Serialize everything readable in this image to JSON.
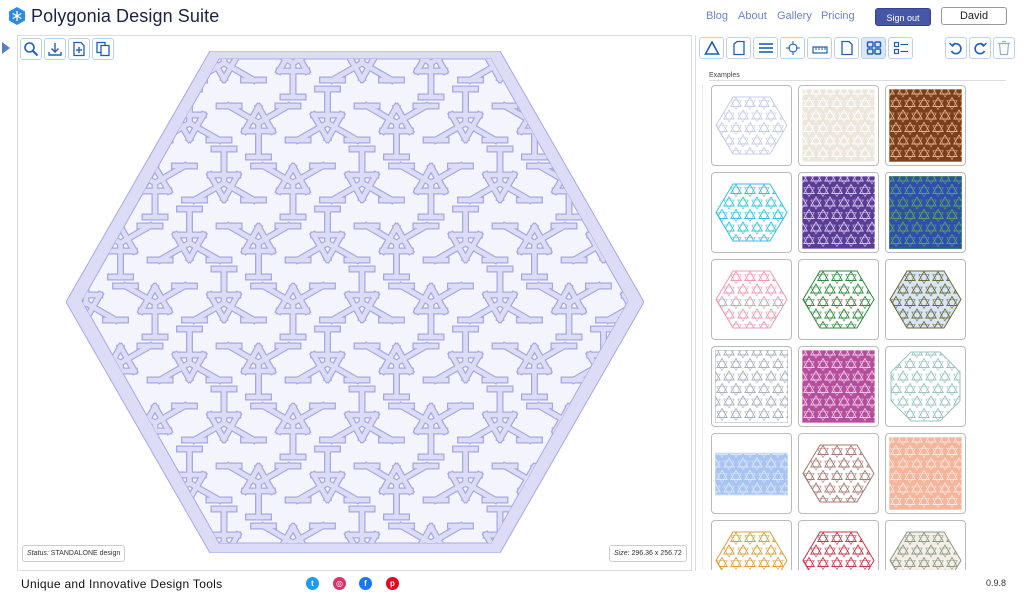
{
  "header": {
    "app_title": "Polygonia Design Suite",
    "nav": [
      "Blog",
      "About",
      "Gallery",
      "Pricing"
    ],
    "signout_label": "Sign out",
    "user_name": "David"
  },
  "canvas": {
    "toolbar_icons": [
      "zoom-icon",
      "download-icon",
      "new-page-icon",
      "copy-page-icon"
    ],
    "status_label": "Status:",
    "status_value": "STANDALONE design",
    "size_label": "Size:",
    "size_value": "296.36 x 256.72"
  },
  "panel": {
    "toolbar_icons": [
      "triangle-icon",
      "page-corner-icon",
      "lines-icon",
      "crosshair-icon",
      "ruler-icon",
      "document-icon",
      "grid-view-icon",
      "list-view-icon"
    ],
    "right_icons": [
      "undo-icon",
      "redo-icon",
      "trash-icon"
    ],
    "examples_label": "Examples",
    "thumbnails": [
      {
        "name": "lavender-hexagon",
        "shape": "hex",
        "bg": "#ffffff",
        "stroke": "#c7cbe8"
      },
      {
        "name": "cream-lattice",
        "shape": "square",
        "bg": "#ece6dc",
        "stroke": "#ffffff"
      },
      {
        "name": "copper-tiles",
        "shape": "square",
        "bg": "#7a3f1d",
        "stroke": "#e6b08a"
      },
      {
        "name": "cyan-hexagon",
        "shape": "hex",
        "bg": "#ffffff",
        "stroke": "#34c3dd"
      },
      {
        "name": "purple-lattice",
        "shape": "square",
        "bg": "#5b3e94",
        "stroke": "#d4c6f2"
      },
      {
        "name": "blue-green-lattice",
        "shape": "square",
        "bg": "#2f4fa8",
        "stroke": "#5aa16a"
      },
      {
        "name": "pink-hexagon",
        "shape": "hex",
        "bg": "#ffffff",
        "stroke": "#f09ab0"
      },
      {
        "name": "green-hexagon",
        "shape": "hex",
        "bg": "#ffffff",
        "stroke": "#2f8a3f"
      },
      {
        "name": "olive-hexagon",
        "shape": "hex",
        "bg": "#d8e6f4",
        "stroke": "#6d6a3a"
      },
      {
        "name": "gray-lattice",
        "shape": "square",
        "bg": "#ffffff",
        "stroke": "#aab0bd"
      },
      {
        "name": "magenta-tiles",
        "shape": "square",
        "bg": "#b44f9c",
        "stroke": "#f4c8e8"
      },
      {
        "name": "teal-octagon",
        "shape": "oct",
        "bg": "#ffffff",
        "stroke": "#9ac4c0"
      },
      {
        "name": "blue-band",
        "shape": "band",
        "bg": "#a9c4f1",
        "stroke": "#d9e6fb"
      },
      {
        "name": "mauve-hexagon",
        "shape": "hex",
        "bg": "#ffffff",
        "stroke": "#a77a72"
      },
      {
        "name": "salmon-tiles",
        "shape": "square",
        "bg": "#f3b59b",
        "stroke": "#fbe4d9"
      },
      {
        "name": "gold-hexagon",
        "shape": "hex",
        "bg": "#ffffff",
        "stroke": "#d9a13a"
      },
      {
        "name": "red-hexagon",
        "shape": "hex",
        "bg": "#ffffff",
        "stroke": "#c9354a"
      },
      {
        "name": "sage-hexagon",
        "shape": "hex",
        "bg": "#f4eee6",
        "stroke": "#8d9a86"
      }
    ]
  },
  "footer": {
    "tagline": "Unique and Innovative Design Tools",
    "social": [
      {
        "name": "twitter-icon",
        "glyph": "t",
        "color": "#1d9bf0"
      },
      {
        "name": "instagram-icon",
        "glyph": "◎",
        "color": "#d6336c"
      },
      {
        "name": "facebook-icon",
        "glyph": "f",
        "color": "#1877f2"
      },
      {
        "name": "pinterest-icon",
        "glyph": "p",
        "color": "#e60023"
      }
    ],
    "version": "0.9.8"
  },
  "colors": {
    "pattern_fill": "#dcdcf6",
    "pattern_stroke": "#a6a9e0",
    "accent": "#4856a8"
  }
}
